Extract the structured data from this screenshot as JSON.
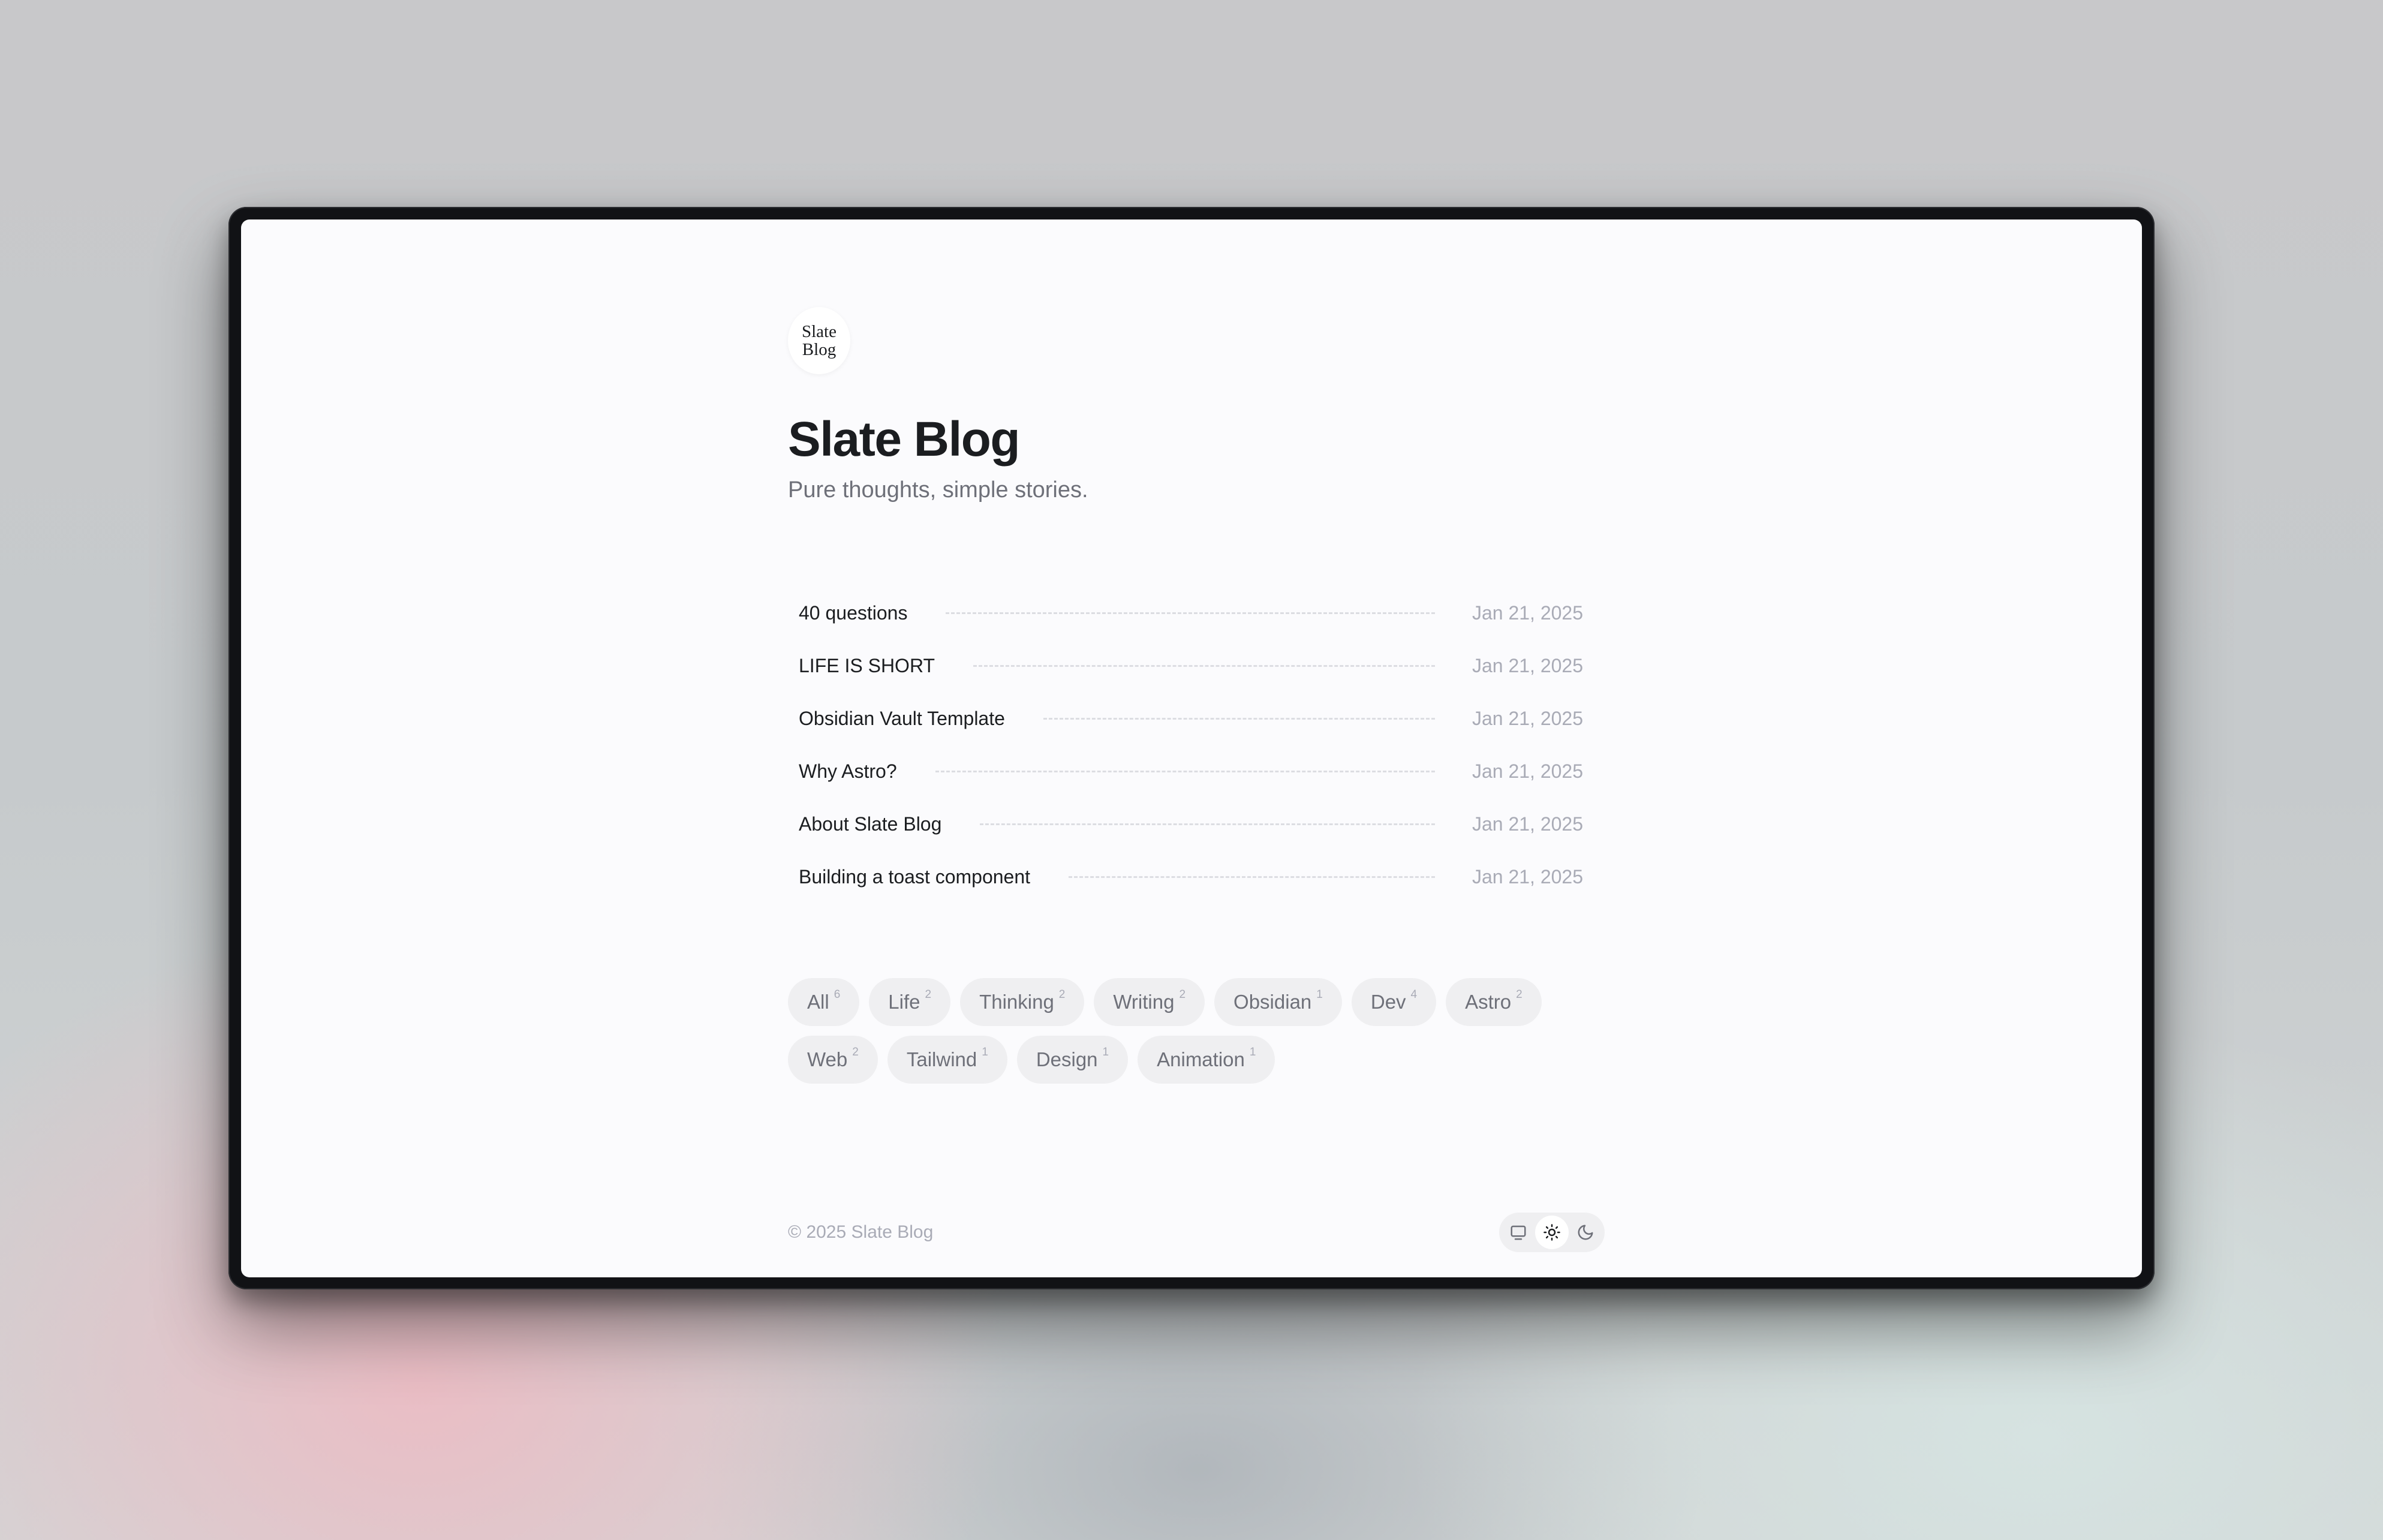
{
  "site": {
    "logo_line1": "Slate",
    "logo_line2": "Blog",
    "title": "Slate Blog",
    "tagline": "Pure thoughts, simple stories."
  },
  "posts": [
    {
      "title": "40 questions",
      "date": "Jan 21, 2025"
    },
    {
      "title": "LIFE IS SHORT",
      "date": "Jan 21, 2025"
    },
    {
      "title": "Obsidian Vault Template",
      "date": "Jan 21, 2025"
    },
    {
      "title": "Why Astro?",
      "date": "Jan 21, 2025"
    },
    {
      "title": "About Slate Blog",
      "date": "Jan 21, 2025"
    },
    {
      "title": "Building a toast component",
      "date": "Jan 21, 2025"
    }
  ],
  "tags": [
    {
      "name": "All",
      "count": "6"
    },
    {
      "name": "Life",
      "count": "2"
    },
    {
      "name": "Thinking",
      "count": "2"
    },
    {
      "name": "Writing",
      "count": "2"
    },
    {
      "name": "Obsidian",
      "count": "1"
    },
    {
      "name": "Dev",
      "count": "4"
    },
    {
      "name": "Astro",
      "count": "2"
    },
    {
      "name": "Web",
      "count": "2"
    },
    {
      "name": "Tailwind",
      "count": "1"
    },
    {
      "name": "Design",
      "count": "1"
    },
    {
      "name": "Animation",
      "count": "1"
    }
  ],
  "footer": {
    "copyright": "© 2025 Slate Blog",
    "theme_options": [
      {
        "icon": "monitor-icon",
        "label": "System"
      },
      {
        "icon": "sun-icon",
        "label": "Light",
        "active": true
      },
      {
        "icon": "moon-icon",
        "label": "Dark"
      }
    ]
  },
  "colors": {
    "text": "#1b1d20",
    "muted": "#6e7079",
    "subtle": "#a9abb6",
    "tag_bg": "#efeff1",
    "page_bg": "#fbfbfd"
  }
}
